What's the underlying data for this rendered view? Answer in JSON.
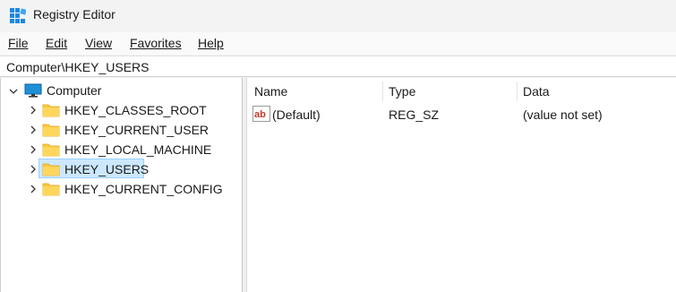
{
  "window": {
    "title": "Registry Editor",
    "icon": "registry-editor-icon"
  },
  "menu": [
    {
      "label": "File"
    },
    {
      "label": "Edit"
    },
    {
      "label": "View"
    },
    {
      "label": "Favorites"
    },
    {
      "label": "Help"
    }
  ],
  "address": {
    "path": "Computer\\HKEY_USERS"
  },
  "tree": {
    "root": {
      "label": "Computer",
      "expanded": true,
      "icon": "computer-icon"
    },
    "children": [
      {
        "label": "HKEY_CLASSES_ROOT",
        "icon": "folder-icon",
        "selected": false
      },
      {
        "label": "HKEY_CURRENT_USER",
        "icon": "folder-icon",
        "selected": false
      },
      {
        "label": "HKEY_LOCAL_MACHINE",
        "icon": "folder-icon",
        "selected": false
      },
      {
        "label": "HKEY_USERS",
        "icon": "folder-icon",
        "selected": true
      },
      {
        "label": "HKEY_CURRENT_CONFIG",
        "icon": "folder-icon",
        "selected": false
      }
    ]
  },
  "values_list": {
    "columns": [
      "Name",
      "Type",
      "Data"
    ],
    "rows": [
      {
        "name": "(Default)",
        "type": "REG_SZ",
        "data": "(value not set)",
        "icon": "string-value-icon"
      }
    ]
  },
  "colors": {
    "selection_fill": "#cce8ff",
    "selection_border": "#99d1ff",
    "folder": "#ffc83d",
    "accent": "#0078d4"
  }
}
